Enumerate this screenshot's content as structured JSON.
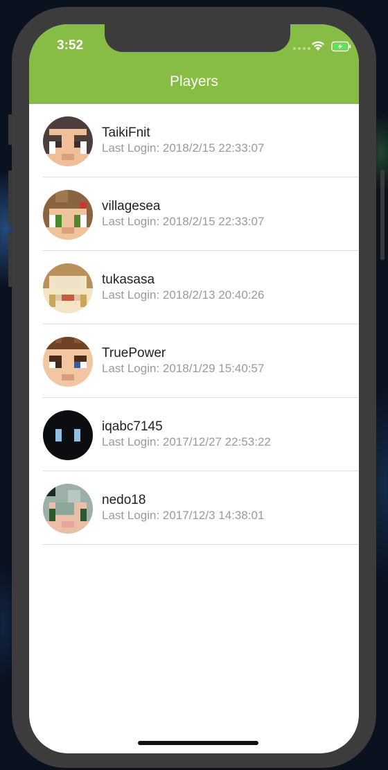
{
  "status_bar": {
    "time": "3:52",
    "icons": [
      "signal-dots-icon",
      "wifi-icon",
      "battery-charging-icon"
    ]
  },
  "nav": {
    "title": "Players",
    "color": "#87bd44"
  },
  "players": [
    {
      "name": "TaikiFnit",
      "last_login": "Last Login: 2018/2/15 22:33:07",
      "avatar": "pixel-avatar-taikifnit"
    },
    {
      "name": "villagesea",
      "last_login": "Last Login: 2018/2/15 22:33:07",
      "avatar": "pixel-avatar-villagesea"
    },
    {
      "name": "tukasasa",
      "last_login": "Last Login: 2018/2/13 20:40:26",
      "avatar": "pixel-avatar-tukasasa"
    },
    {
      "name": "TruePower",
      "last_login": "Last Login: 2018/1/29 15:40:57",
      "avatar": "pixel-avatar-truepower"
    },
    {
      "name": "iqabc7145",
      "last_login": "Last Login: 2017/12/27 22:53:22",
      "avatar": "pixel-avatar-iqabc7145"
    },
    {
      "name": "nedo18",
      "last_login": "Last Login: 2017/12/3 14:38:01",
      "avatar": "pixel-avatar-nedo18"
    }
  ]
}
